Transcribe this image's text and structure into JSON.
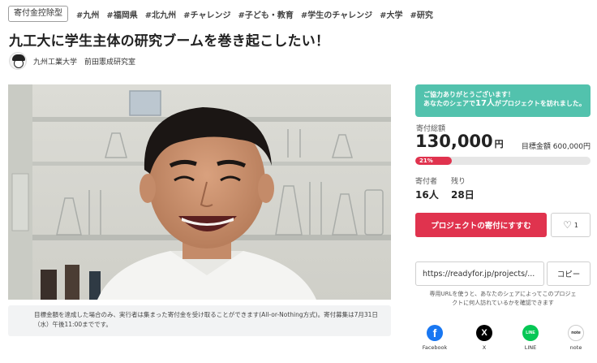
{
  "tags": {
    "badge": "寄付金控除型",
    "items": [
      "#九州",
      "#福岡県",
      "#北九州",
      "#チャレンジ",
      "#子ども・教育",
      "#学生のチャレンジ",
      "#大学",
      "#研究"
    ]
  },
  "project": {
    "title": "九工大に学生主体の研究ブームを巻き起こしたい！",
    "owner": "九州工業大学　前田憲成研究室"
  },
  "notice": {
    "line1": "目標金額を達成した場合のみ、実行者は集まった寄付金を受け取ることができます(All-or-Nothing方式)。寄付募集は7月31日",
    "line2": "（水）午後11:00までです。"
  },
  "thanks": {
    "line1": "ご協力ありがとうございます！",
    "line2_pre": "あなたのシェアで",
    "line2_count": "17人",
    "line2_post": "がプロジェクトを訪れました。"
  },
  "funding": {
    "raised_label": "寄付総額",
    "raised_amount": "130,000",
    "raised_unit": "円",
    "goal_label": "目標金額 600,000円",
    "progress_text": "21%",
    "progress": 0.21,
    "supporters_label": "寄付者",
    "supporters_value": "16人",
    "remaining_label": "残り",
    "remaining_value": "28日"
  },
  "actions": {
    "support_label": "プロジェクトの寄付にすすむ",
    "like_count": "1",
    "share_url": "https://readyfor.jp/projects/...",
    "copy_label": "コピー",
    "url_note_line1": "専用URLを使うと、あなたのシェアによってこのプロジェ",
    "url_note_line2": "クトに何人訪れているかを確認できます"
  },
  "share": [
    {
      "label": "Facebook",
      "glyph": "f",
      "color": "#1877f2",
      "icon": "facebook-icon"
    },
    {
      "label": "X",
      "glyph": "𝕏",
      "color": "#000000",
      "icon": "x-icon"
    },
    {
      "label": "LINE",
      "glyph": "LINE",
      "color": "#06c755",
      "icon": "line-icon"
    },
    {
      "label": "note",
      "glyph": "note",
      "color": "#ffffff",
      "icon": "note-icon"
    }
  ],
  "colors": {
    "accent": "#e0334e",
    "thanks_bg": "#52c2ad"
  }
}
